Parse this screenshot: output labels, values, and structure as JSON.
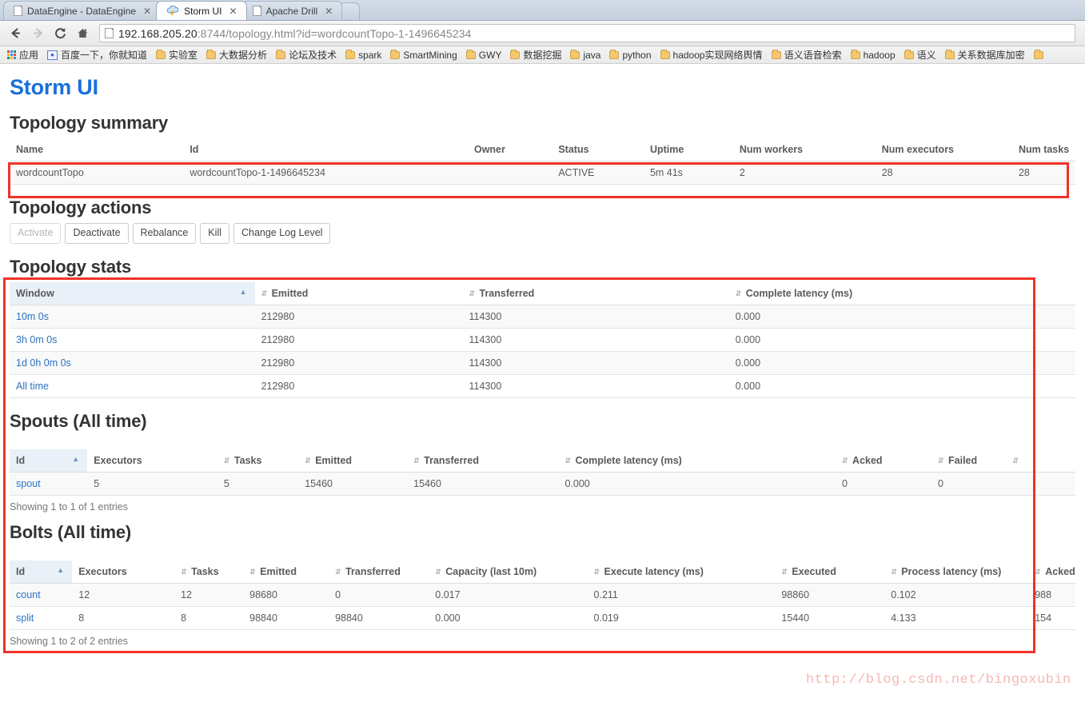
{
  "browser": {
    "tabs": [
      {
        "title": "DataEngine - DataEngine",
        "icon": "document-icon",
        "active": false,
        "close_label": "✕"
      },
      {
        "title": "Storm UI",
        "icon": "storm-cloud-icon",
        "active": true,
        "close_label": "✕"
      },
      {
        "title": "Apache Drill",
        "icon": "document-icon",
        "active": false,
        "close_label": "✕"
      }
    ],
    "nav": {
      "back_label": "back-arrow",
      "forward_label": "forward-arrow",
      "reload_label": "reload",
      "home_label": "home"
    },
    "url": {
      "host": "192.168.205.20",
      "path": ":8744/topology.html?id=wordcountTopo-1-1496645234",
      "full": "192.168.205.20:8744/topology.html?id=wordcountTopo-1-1496645234"
    },
    "bookmarks": {
      "apps_label": "应用",
      "items": [
        "百度一下，你就知道",
        "实验室",
        "大数据分析",
        "论坛及技术",
        "spark",
        "SmartMining",
        "GWY",
        "数据挖掘",
        "java",
        "python",
        "hadoop实现网络舆情",
        "语义语音检索",
        "hadoop",
        "语义",
        "关系数据库加密"
      ]
    }
  },
  "page": {
    "brand": "Storm UI",
    "watermark": "http://blog.csdn.net/bingoxubin",
    "topology_summary": {
      "heading": "Topology summary",
      "columns": [
        "Name",
        "Id",
        "Owner",
        "Status",
        "Uptime",
        "Num workers",
        "Num executors",
        "Num tasks"
      ],
      "rows": [
        {
          "name": "wordcountTopo",
          "id": "wordcountTopo-1-1496645234",
          "owner": "",
          "status": "ACTIVE",
          "uptime": "5m 41s",
          "num_workers": "2",
          "num_executors": "28",
          "num_tasks": "28"
        }
      ]
    },
    "topology_actions": {
      "heading": "Topology actions",
      "buttons": [
        {
          "label": "Activate",
          "disabled": true
        },
        {
          "label": "Deactivate",
          "disabled": false
        },
        {
          "label": "Rebalance",
          "disabled": false
        },
        {
          "label": "Kill",
          "disabled": false
        },
        {
          "label": "Change Log Level",
          "disabled": false
        }
      ]
    },
    "topology_stats": {
      "heading": "Topology stats",
      "columns": [
        "Window",
        "Emitted",
        "Transferred",
        "Complete latency (ms)"
      ],
      "sorted_column": "Window",
      "rows": [
        {
          "window": "10m 0s",
          "emitted": "212980",
          "transferred": "114300",
          "complete_latency": "0.000"
        },
        {
          "window": "3h 0m 0s",
          "emitted": "212980",
          "transferred": "114300",
          "complete_latency": "0.000"
        },
        {
          "window": "1d 0h 0m 0s",
          "emitted": "212980",
          "transferred": "114300",
          "complete_latency": "0.000"
        },
        {
          "window": "All time",
          "emitted": "212980",
          "transferred": "114300",
          "complete_latency": "0.000"
        }
      ]
    },
    "spouts": {
      "heading": "Spouts (All time)",
      "columns": [
        "Id",
        "Executors",
        "Tasks",
        "Emitted",
        "Transferred",
        "Complete latency (ms)",
        "Acked",
        "Failed"
      ],
      "sorted_column": "Id",
      "rows": [
        {
          "id": "spout",
          "executors": "5",
          "tasks": "5",
          "emitted": "15460",
          "transferred": "15460",
          "complete_latency": "0.000",
          "acked": "0",
          "failed": "0"
        }
      ],
      "entries": "Showing 1 to 1 of 1 entries"
    },
    "bolts": {
      "heading": "Bolts (All time)",
      "columns": [
        "Id",
        "Executors",
        "Tasks",
        "Emitted",
        "Transferred",
        "Capacity (last 10m)",
        "Execute latency (ms)",
        "Executed",
        "Process latency (ms)",
        "Acked"
      ],
      "sorted_column": "Id",
      "rows": [
        {
          "id": "count",
          "executors": "12",
          "tasks": "12",
          "emitted": "98680",
          "transferred": "0",
          "capacity": "0.017",
          "execute_latency": "0.211",
          "executed": "98860",
          "process_latency": "0.102",
          "acked": "988"
        },
        {
          "id": "split",
          "executors": "8",
          "tasks": "8",
          "emitted": "98840",
          "transferred": "98840",
          "capacity": "0.000",
          "execute_latency": "0.019",
          "executed": "15440",
          "process_latency": "4.133",
          "acked": "154"
        }
      ],
      "entries": "Showing 1 to 2 of 2 entries"
    }
  },
  "colors": {
    "brand_blue": "#1a6fdb",
    "link_blue": "#2b73c4",
    "annotation_red": "#f03228",
    "sorted_header_bg": "#e9f0f7"
  }
}
